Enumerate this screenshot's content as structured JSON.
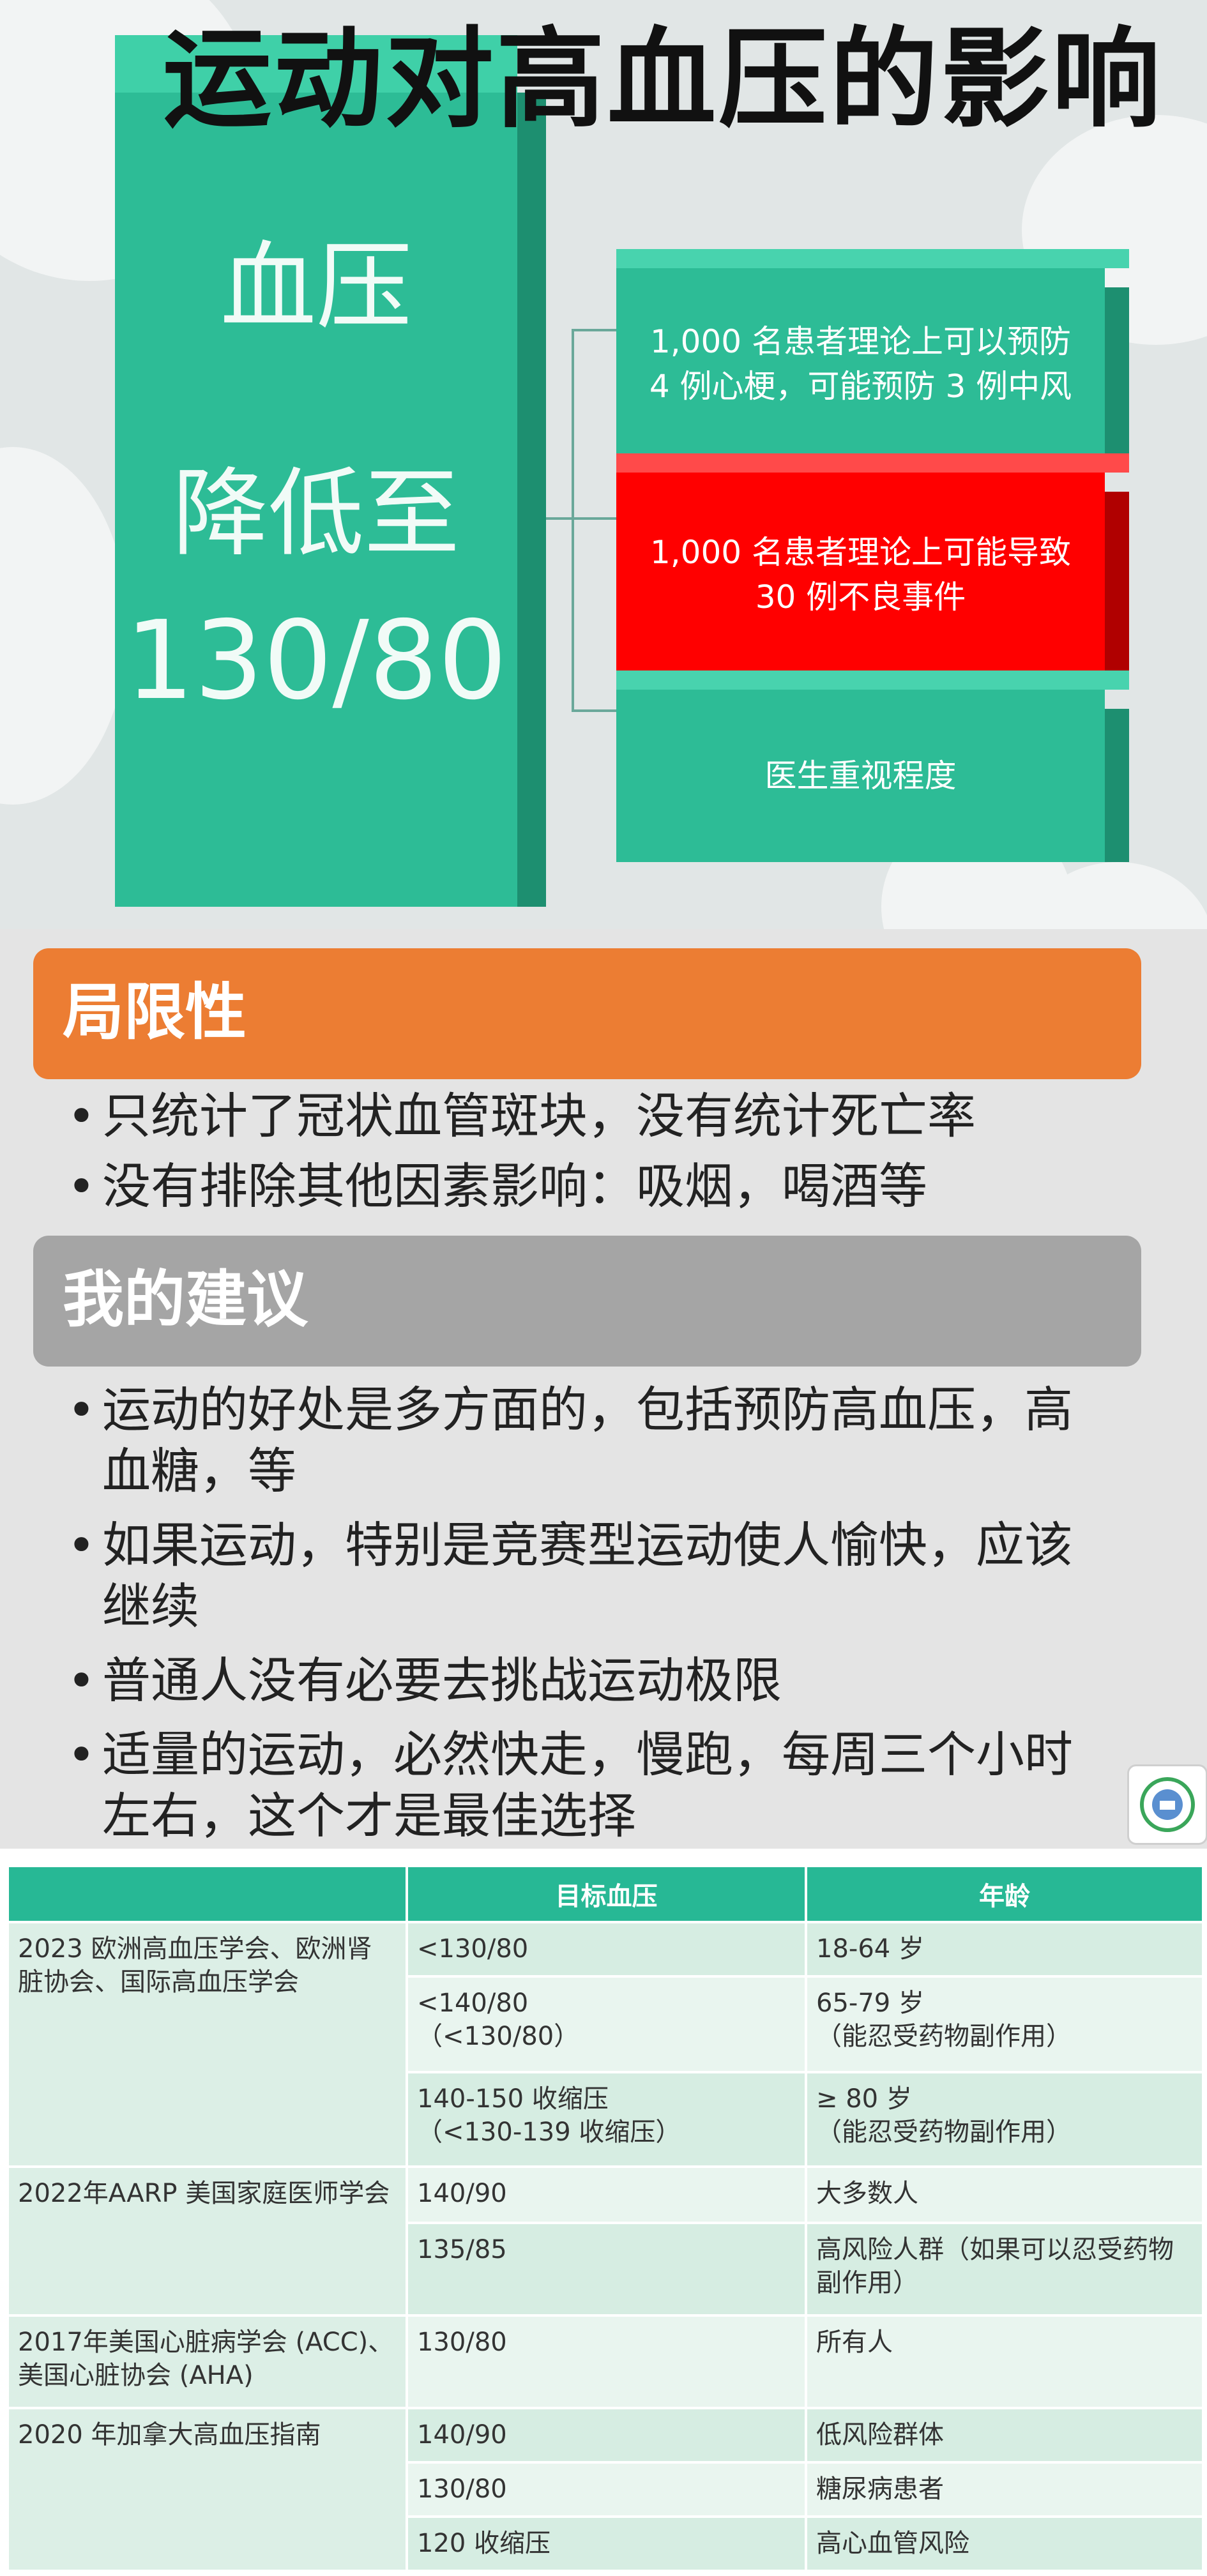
{
  "slide": {
    "title": "运动对高血压的影响",
    "big_box": {
      "label": "血压",
      "action": "降低至",
      "value": "130/80"
    },
    "info_boxes": [
      {
        "line1": "1,000 名患者理论上可以预防",
        "line2": "4 例心梗，可能预防 3 例中风",
        "color": "#2dbc96"
      },
      {
        "line1": "1,000 名患者理论上可能导致",
        "line2": "30 例不良事件",
        "color": "#ff0000"
      },
      {
        "line1": "医生重视程度",
        "line2": "",
        "color": "#2dbc96"
      }
    ]
  },
  "notes": {
    "limitations": {
      "heading": "局限性",
      "items": [
        "只统计了冠状血管斑块，没有统计死亡率",
        "没有排除其他因素影响：吸烟，喝酒等"
      ]
    },
    "advice": {
      "heading": "我的建议",
      "items": [
        "运动的好处是多方面的，包括预防高血压，高血糖，等",
        "如果运动，特别是竞赛型运动使人愉快，应该继续",
        "普通人没有必要去挑战运动极限",
        "适量的运动，必然快走，慢跑，每周三个小时左右，这个才是最佳选择"
      ]
    },
    "logo_icon": "laurel-logo-icon"
  },
  "table": {
    "headers": [
      "",
      "目标血压",
      "年龄"
    ],
    "groups": [
      {
        "org": "2023 欧洲高血压学会、欧洲肾脏协会、国际高血压学会",
        "rows": [
          {
            "target": "<130/80",
            "target2": "",
            "age": "18-64 岁",
            "age2": ""
          },
          {
            "target": "<140/80",
            "target2": "（<130/80）",
            "age": "65-79 岁",
            "age2": "（能忍受药物副作用）"
          },
          {
            "target": "140-150 收缩压",
            "target2": "（<130-139 收缩压）",
            "age": "≥ 80 岁",
            "age2": "（能忍受药物副作用）"
          }
        ]
      },
      {
        "org": "2022年AARP 美国家庭医师学会",
        "rows": [
          {
            "target": "140/90",
            "target2": "",
            "age": "大多数人",
            "age2": ""
          },
          {
            "target": "135/85",
            "target2": "",
            "age": "高风险人群（如果可以忍受药物副作用）",
            "age2": ""
          }
        ]
      },
      {
        "org": "2017年美国心脏病学会 (ACC)、美国心脏协会 (AHA)",
        "rows": [
          {
            "target": "130/80",
            "target2": "",
            "age": "所有人",
            "age2": ""
          }
        ]
      },
      {
        "org": "2020 年加拿大高血压指南",
        "rows": [
          {
            "target": "140/90",
            "target2": "",
            "age": "低风险群体",
            "age2": ""
          },
          {
            "target": "130/80",
            "target2": "",
            "age": "糖尿病患者",
            "age2": ""
          },
          {
            "target": "120 收缩压",
            "target2": "",
            "age": "高心血管风险",
            "age2": ""
          }
        ]
      }
    ]
  }
}
